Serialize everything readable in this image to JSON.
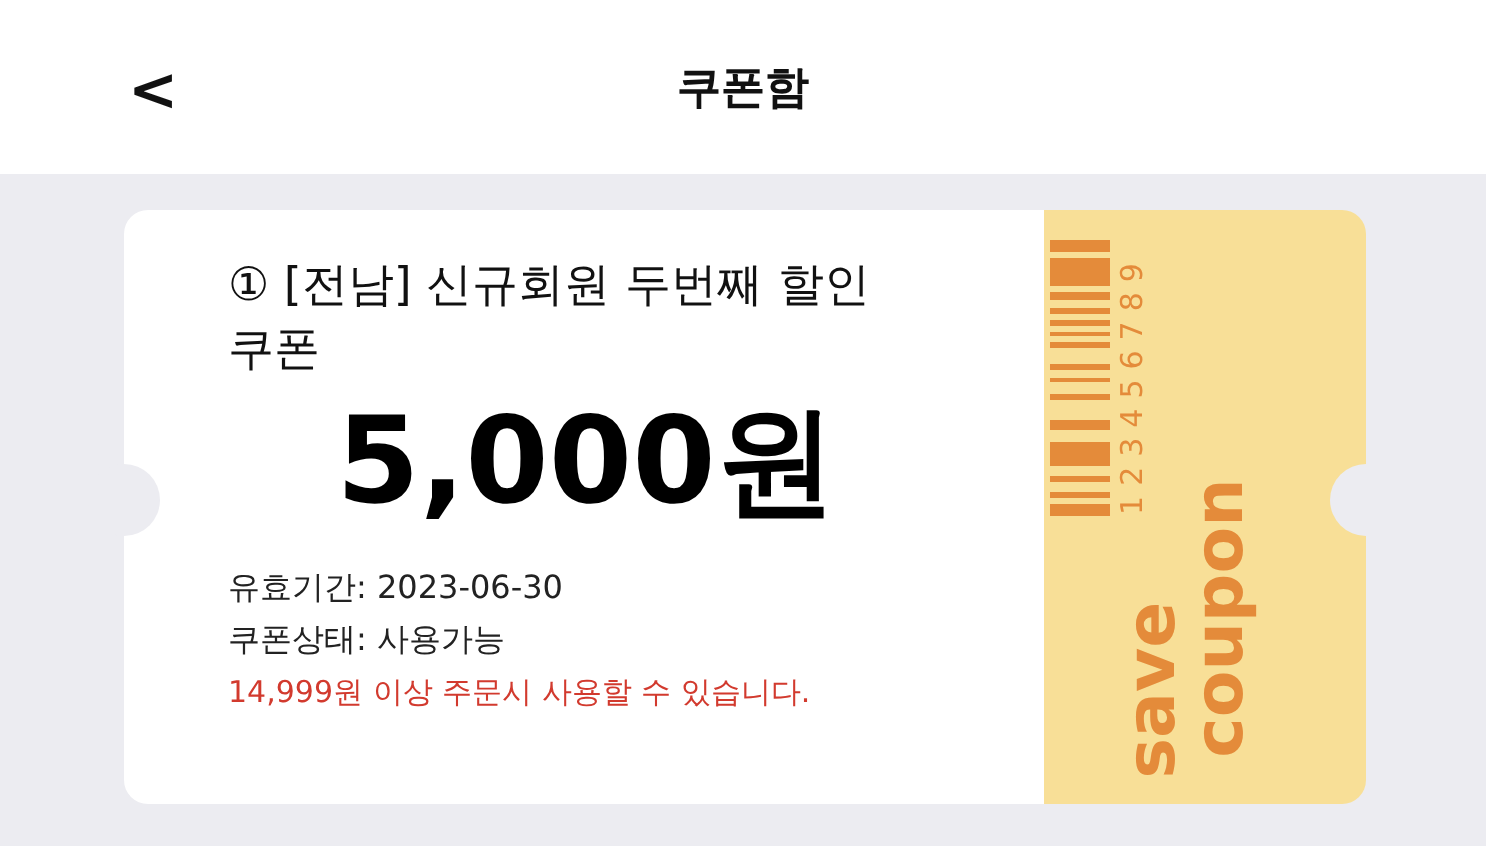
{
  "header": {
    "back": "<",
    "title": "쿠폰함"
  },
  "coupon": {
    "title": "① [전남] 신규회원 두번째 할인 쿠폰",
    "amount": "5,000원",
    "details": [
      "유효기간: 2023-06-30",
      "쿠폰상태: 사용가능"
    ],
    "condition": "14,999원 이상 주문시 사용할 수 있습니다.",
    "stub": {
      "barcode_number": "123456789",
      "label_lines": [
        "save",
        "coupon"
      ]
    }
  }
}
